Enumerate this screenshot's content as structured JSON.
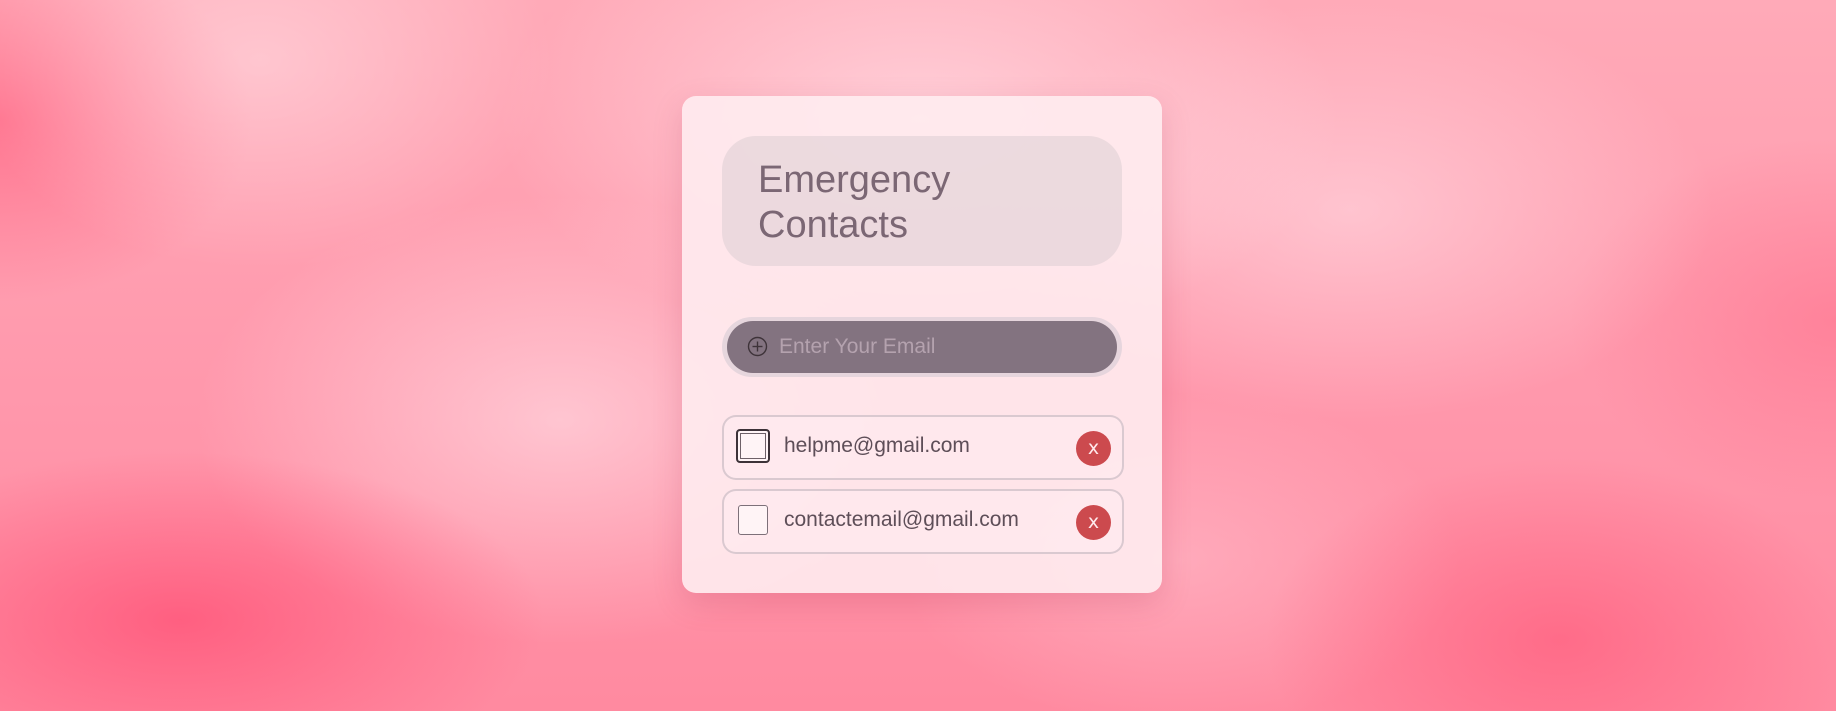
{
  "page": {
    "title": "Emergency Contacts"
  },
  "email_input": {
    "placeholder": "Enter Your Email",
    "icon": "plus-circle-icon"
  },
  "contacts": [
    {
      "email": "helpme@gmail.com",
      "checked": false,
      "focused": true,
      "delete_label": "x"
    },
    {
      "email": "contactemail@gmail.com",
      "checked": false,
      "focused": false,
      "delete_label": "x"
    }
  ],
  "colors": {
    "background": "#ff98ac",
    "card": "#ffecf0",
    "input": "#837380",
    "delete": "#cc4a4e",
    "title_text": "#7b6774"
  }
}
